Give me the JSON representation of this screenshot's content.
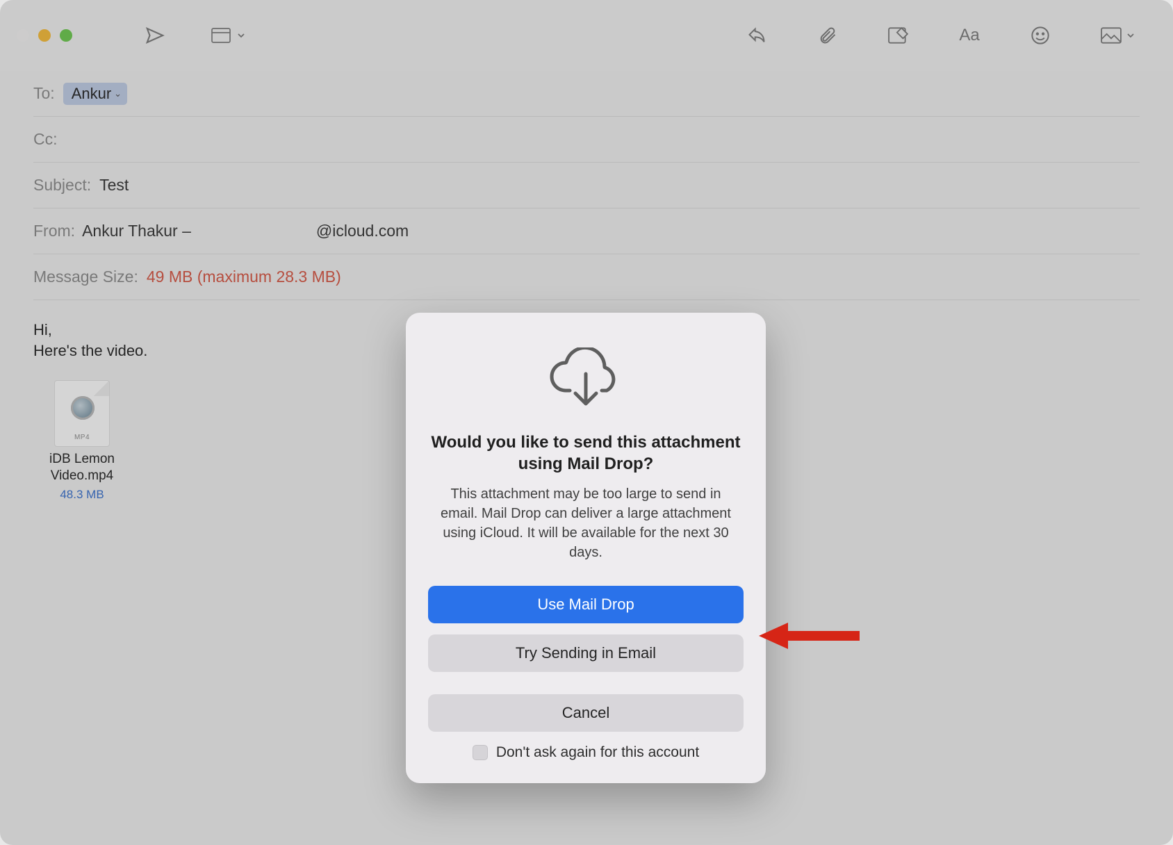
{
  "traffic": {
    "close": "close",
    "min": "minimize",
    "max": "maximize"
  },
  "toolbar": {
    "send": "send",
    "header_menu": "header-fields",
    "reply": "reply",
    "attach": "attach",
    "markup": "markup",
    "format": "format-text",
    "emoji": "emoji",
    "photos": "insert-photo"
  },
  "fields": {
    "to_label": "To:",
    "to_chip": "Ankur",
    "cc_label": "Cc:",
    "subject_label": "Subject:",
    "subject_value": "Test",
    "from_label": "From:",
    "from_name": "Ankur Thakur –",
    "from_domain": "@icloud.com",
    "size_label": "Message Size:",
    "size_warn": "49 MB (maximum 28.3 MB)"
  },
  "body": {
    "line1": "Hi,",
    "line2": "Here's the video."
  },
  "attachment": {
    "badge": "MP4",
    "name_line1": "iDB Lemon",
    "name_line2": "Video.mp4",
    "size": "48.3 MB"
  },
  "dialog": {
    "title": "Would you like to send this attachment using Mail Drop?",
    "message": "This attachment may be too large to send in email. Mail Drop can deliver a large attachment using iCloud. It will be available for the next 30 days.",
    "btn_primary": "Use Mail Drop",
    "btn_secondary": "Try Sending in Email",
    "btn_cancel": "Cancel",
    "checkbox_label": "Don't ask again for this account"
  }
}
